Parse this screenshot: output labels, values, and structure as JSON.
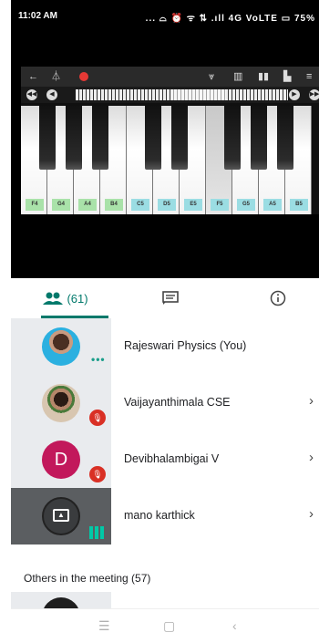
{
  "status_bar": {
    "time": "11:02 AM",
    "indicators": "... ⌓ ⏰ ᯤ ⇅ .ıll 4G VoLTE",
    "battery": "75%"
  },
  "piano": {
    "toolbar_icons": [
      "back-arrow-icon",
      "metronome-icon",
      "record-icon",
      "mixer-icon",
      "keyboard-icon",
      "pause-icon",
      "folder-icon",
      "menu-icon"
    ],
    "nav_icons": [
      "rewind-icon",
      "prev-icon",
      "next-icon",
      "fast-forward-icon"
    ],
    "white_keys": [
      "F4",
      "G4",
      "A4",
      "B4",
      "C5",
      "D5",
      "E5",
      "F5",
      "G5",
      "A5",
      "B5"
    ],
    "pressed_key": "F5"
  },
  "tabs": {
    "people_count": "(61)",
    "items": [
      "people",
      "chat",
      "info"
    ]
  },
  "participants": [
    {
      "name": "Rajeswari Physics (You)",
      "state": "speaking"
    },
    {
      "name": "Vaijayanthimala CSE",
      "state": "muted"
    },
    {
      "name": "Devibhalambigai V",
      "initial": "D",
      "state": "muted"
    },
    {
      "name": "mano karthick",
      "state": "presenting"
    }
  ],
  "others_heading": "Others in the meeting (57)",
  "colors": {
    "accent": "#00796b",
    "mute": "#d93025",
    "avatar_d": "#c2185b"
  }
}
